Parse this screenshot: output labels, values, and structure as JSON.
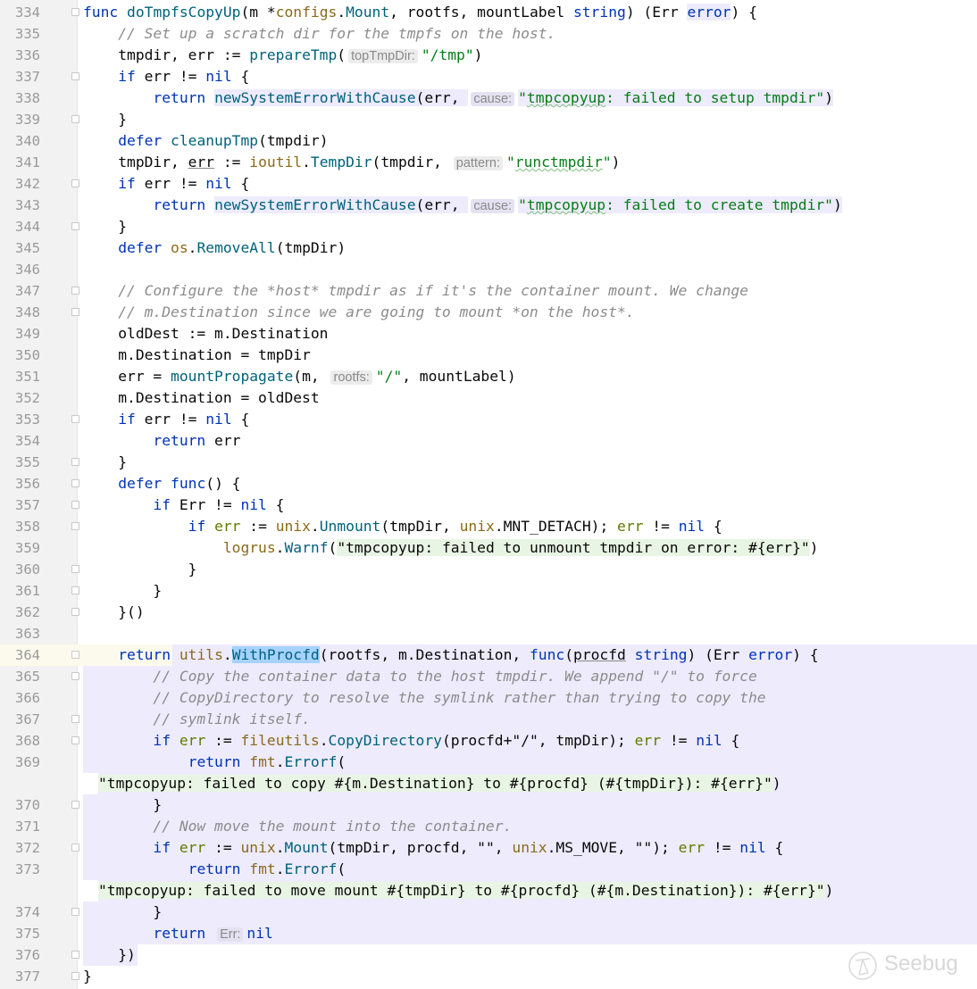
{
  "colors": {
    "keyword": "#0033b3",
    "function": "#00627a",
    "package": "#8a6a1c",
    "comment": "#8c8c8c",
    "string": "#067d17",
    "scope_highlight": "#edebfc",
    "current_line": "#fcfaed",
    "selection": "#a6d2ff"
  },
  "watermark": "Seebug",
  "lines": [
    {
      "n": "334",
      "fold": true,
      "t": [
        [
          "k",
          "func"
        ],
        [
          "",
          " "
        ],
        [
          "f",
          "doTmpfsCopyUp"
        ],
        [
          "",
          "(m *"
        ],
        [
          "p",
          "configs"
        ],
        [
          "",
          "."
        ],
        [
          "f",
          "Mount"
        ],
        [
          "",
          ", rootfs, mountLabel "
        ],
        [
          "k",
          "string"
        ],
        [
          "",
          ") (Err "
        ],
        [
          "kb",
          "error"
        ],
        [
          "",
          ") {"
        ]
      ]
    },
    {
      "n": "335",
      "t": [
        [
          "",
          "    "
        ],
        [
          "c",
          "// Set up a scratch dir for the tmpfs on the host."
        ]
      ]
    },
    {
      "n": "336",
      "t": [
        [
          "",
          "    tmpdir, err := "
        ],
        [
          "f",
          "prepareTmp"
        ],
        [
          "",
          "("
        ],
        [
          "h",
          "topTmpDir:"
        ],
        [
          "s",
          "\"/tmp\""
        ],
        [
          "",
          ")"
        ]
      ]
    },
    {
      "n": "337",
      "fold": true,
      "t": [
        [
          "",
          "    "
        ],
        [
          "k",
          "if"
        ],
        [
          "",
          " err != "
        ],
        [
          "k",
          "nil"
        ],
        [
          "",
          " {"
        ]
      ]
    },
    {
      "n": "338",
      "t": [
        [
          "",
          "        "
        ],
        [
          "k",
          "return"
        ],
        [
          "",
          " "
        ],
        [
          "f lv",
          "newSystemErrorWithCause"
        ],
        [
          "lv",
          "(err, "
        ],
        [
          "h lv",
          "cause:"
        ],
        [
          "s lv",
          "\""
        ],
        [
          "s lv w",
          "tmpcopyup"
        ],
        [
          "s lv",
          ": failed to setup tmpdir\""
        ],
        [
          "lv",
          ")"
        ]
      ]
    },
    {
      "n": "339",
      "fold": true,
      "t": [
        [
          "",
          "    }"
        ]
      ]
    },
    {
      "n": "340",
      "t": [
        [
          "",
          "    "
        ],
        [
          "k",
          "defer"
        ],
        [
          "",
          " "
        ],
        [
          "f",
          "cleanupTmp"
        ],
        [
          "",
          "(tmpdir)"
        ]
      ]
    },
    {
      "n": "341",
      "t": [
        [
          "",
          "    tmpDir, "
        ],
        [
          "u",
          "err"
        ],
        [
          "",
          " := "
        ],
        [
          "p",
          "ioutil"
        ],
        [
          "",
          "."
        ],
        [
          "f",
          "TempDir"
        ],
        [
          "",
          "(tmpdir, "
        ],
        [
          "h",
          "pattern:"
        ],
        [
          "s",
          "\""
        ],
        [
          "s w",
          "runctmpdir"
        ],
        [
          "s",
          "\""
        ],
        [
          "",
          ")"
        ]
      ]
    },
    {
      "n": "342",
      "fold": true,
      "t": [
        [
          "",
          "    "
        ],
        [
          "k",
          "if"
        ],
        [
          "",
          " err != "
        ],
        [
          "k",
          "nil"
        ],
        [
          "",
          " {"
        ]
      ]
    },
    {
      "n": "343",
      "t": [
        [
          "",
          "        "
        ],
        [
          "k",
          "return"
        ],
        [
          "",
          " "
        ],
        [
          "f lv",
          "newSystemErrorWithCause"
        ],
        [
          "lv",
          "(err, "
        ],
        [
          "h lv",
          "cause:"
        ],
        [
          "s lv",
          "\""
        ],
        [
          "s lv w",
          "tmpcopyup"
        ],
        [
          "s lv",
          ": failed to create tmpdir\""
        ],
        [
          "lv",
          ")"
        ]
      ]
    },
    {
      "n": "344",
      "fold": true,
      "t": [
        [
          "",
          "    }"
        ]
      ]
    },
    {
      "n": "345",
      "t": [
        [
          "",
          "    "
        ],
        [
          "k",
          "defer"
        ],
        [
          "",
          " "
        ],
        [
          "p",
          "os"
        ],
        [
          "",
          "."
        ],
        [
          "f",
          "RemoveAll"
        ],
        [
          "",
          "(tmpDir)"
        ]
      ]
    },
    {
      "n": "346",
      "t": []
    },
    {
      "n": "347",
      "fold": true,
      "t": [
        [
          "",
          "    "
        ],
        [
          "c",
          "// Configure the *host* tmpdir as if it's the container mount. We change"
        ]
      ]
    },
    {
      "n": "348",
      "fold": true,
      "t": [
        [
          "",
          "    "
        ],
        [
          "c",
          "// m.Destination since we are going to mount *on the host*."
        ]
      ]
    },
    {
      "n": "349",
      "t": [
        [
          "",
          "    oldDest := m.Destination"
        ]
      ]
    },
    {
      "n": "350",
      "t": [
        [
          "",
          "    m.Destination = tmpDir"
        ]
      ]
    },
    {
      "n": "351",
      "t": [
        [
          "",
          "    err = "
        ],
        [
          "f",
          "mountPropagate"
        ],
        [
          "",
          "(m, "
        ],
        [
          "h",
          "rootfs:"
        ],
        [
          "s",
          "\"/\""
        ],
        [
          "",
          ", mountLabel)"
        ]
      ]
    },
    {
      "n": "352",
      "t": [
        [
          "",
          "    m.Destination = oldDest"
        ]
      ]
    },
    {
      "n": "353",
      "fold": true,
      "t": [
        [
          "",
          "    "
        ],
        [
          "k",
          "if"
        ],
        [
          "",
          " err != "
        ],
        [
          "k",
          "nil"
        ],
        [
          "",
          " {"
        ]
      ]
    },
    {
      "n": "354",
      "t": [
        [
          "",
          "        "
        ],
        [
          "k",
          "return"
        ],
        [
          "",
          " err"
        ]
      ]
    },
    {
      "n": "355",
      "fold": true,
      "t": [
        [
          "",
          "    }"
        ]
      ]
    },
    {
      "n": "356",
      "fold": true,
      "t": [
        [
          "",
          "    "
        ],
        [
          "k",
          "defer"
        ],
        [
          "",
          " "
        ],
        [
          "k",
          "func"
        ],
        [
          "",
          "() {"
        ]
      ]
    },
    {
      "n": "357",
      "fold": true,
      "t": [
        [
          "",
          "        "
        ],
        [
          "k",
          "if"
        ],
        [
          "",
          " Err != "
        ],
        [
          "k",
          "nil"
        ],
        [
          "",
          " {"
        ]
      ]
    },
    {
      "n": "358",
      "fold": true,
      "t": [
        [
          "",
          "            "
        ],
        [
          "k",
          "if"
        ],
        [
          "",
          " "
        ],
        [
          "v",
          "err"
        ],
        [
          "",
          " := "
        ],
        [
          "p",
          "unix"
        ],
        [
          "",
          "."
        ],
        [
          "f",
          "Unmount"
        ],
        [
          "",
          "(tmpDir, "
        ],
        [
          "p",
          "unix"
        ],
        [
          "",
          ".MNT_DETACH); "
        ],
        [
          "v",
          "err"
        ],
        [
          "",
          " != "
        ],
        [
          "k",
          "nil"
        ],
        [
          "",
          " {"
        ]
      ]
    },
    {
      "n": "359",
      "t": [
        [
          "",
          "                "
        ],
        [
          "p",
          "logrus"
        ],
        [
          "",
          "."
        ],
        [
          "f",
          "Warnf"
        ],
        [
          "",
          "("
        ],
        [
          "sd",
          "\"tmpcopyup: failed to unmount tmpdir on error: #{err}\""
        ],
        [
          "",
          ")"
        ]
      ]
    },
    {
      "n": "360",
      "fold": true,
      "t": [
        [
          "",
          "            }"
        ]
      ]
    },
    {
      "n": "361",
      "fold": true,
      "t": [
        [
          "",
          "        }"
        ]
      ]
    },
    {
      "n": "362",
      "fold": true,
      "t": [
        [
          "",
          "    }()"
        ]
      ]
    },
    {
      "n": "363",
      "t": []
    },
    {
      "n": "364",
      "fold": true,
      "scope_start": true,
      "t": [
        [
          "",
          "    "
        ],
        [
          "k",
          "return"
        ],
        [
          "",
          " "
        ],
        [
          "p",
          "utils"
        ],
        [
          "",
          "."
        ],
        [
          "f sel",
          "WithProcfd"
        ],
        [
          "",
          "(rootfs, m.Destination, "
        ],
        [
          "k",
          "func"
        ],
        [
          "",
          "("
        ],
        [
          "u",
          "procfd"
        ],
        [
          "",
          " "
        ],
        [
          "k",
          "string"
        ],
        [
          "",
          ") (Err "
        ],
        [
          "k",
          "error"
        ],
        [
          "",
          ") {"
        ]
      ]
    },
    {
      "n": "365",
      "fold": true,
      "scope": true,
      "t": [
        [
          "",
          "        "
        ],
        [
          "c",
          "// Copy the container data to the host tmpdir. We append \"/\" to force"
        ]
      ]
    },
    {
      "n": "366",
      "scope": true,
      "t": [
        [
          "",
          "        "
        ],
        [
          "c",
          "// CopyDirectory to resolve the symlink rather than trying to copy the"
        ]
      ]
    },
    {
      "n": "367",
      "fold": true,
      "scope": true,
      "t": [
        [
          "",
          "        "
        ],
        [
          "c",
          "// symlink itself."
        ]
      ]
    },
    {
      "n": "368",
      "fold": true,
      "scope": true,
      "t": [
        [
          "",
          "        "
        ],
        [
          "k",
          "if"
        ],
        [
          "",
          " "
        ],
        [
          "v",
          "err"
        ],
        [
          "",
          " := "
        ],
        [
          "p",
          "fileutils"
        ],
        [
          "",
          "."
        ],
        [
          "f",
          "CopyDirectory"
        ],
        [
          "",
          "(procfd+\"/\", tmpDir); "
        ],
        [
          "v",
          "err"
        ],
        [
          "",
          " != "
        ],
        [
          "k",
          "nil"
        ],
        [
          "",
          " {"
        ]
      ]
    },
    {
      "n": "369",
      "scope": true,
      "t": [
        [
          "",
          "            "
        ],
        [
          "k",
          "return"
        ],
        [
          "",
          " "
        ],
        [
          "p",
          "fmt"
        ],
        [
          "",
          "."
        ],
        [
          "f",
          "Errorf"
        ],
        [
          "",
          "("
        ]
      ]
    },
    {
      "n": "",
      "scope": true,
      "cont": true,
      "t": [
        [
          "sd",
          "\"tmpcopyup: failed to copy #{m.Destination} to #{procfd} (#{tmpDir}): #{err}\""
        ],
        [
          "",
          ")"
        ]
      ]
    },
    {
      "n": "370",
      "fold": true,
      "scope": true,
      "t": [
        [
          "",
          "        }"
        ]
      ]
    },
    {
      "n": "371",
      "scope": true,
      "t": [
        [
          "",
          "        "
        ],
        [
          "c",
          "// Now move the mount into the container."
        ]
      ]
    },
    {
      "n": "372",
      "fold": true,
      "scope": true,
      "t": [
        [
          "",
          "        "
        ],
        [
          "k",
          "if"
        ],
        [
          "",
          " "
        ],
        [
          "v",
          "err"
        ],
        [
          "",
          " := "
        ],
        [
          "p",
          "unix"
        ],
        [
          "",
          "."
        ],
        [
          "f",
          "Mount"
        ],
        [
          "",
          "(tmpDir, procfd, \"\", "
        ],
        [
          "p",
          "unix"
        ],
        [
          "",
          ".MS_MOVE, \"\"); "
        ],
        [
          "v",
          "err"
        ],
        [
          "",
          " != "
        ],
        [
          "k",
          "nil"
        ],
        [
          "",
          " {"
        ]
      ]
    },
    {
      "n": "373",
      "scope": true,
      "t": [
        [
          "",
          "            "
        ],
        [
          "k",
          "return"
        ],
        [
          "",
          " "
        ],
        [
          "p",
          "fmt"
        ],
        [
          "",
          "."
        ],
        [
          "f",
          "Errorf"
        ],
        [
          "",
          "("
        ]
      ]
    },
    {
      "n": "",
      "scope": true,
      "cont": true,
      "t": [
        [
          "sd",
          "\"tmpcopyup: failed to move mount #{tmpDir} to #{procfd} (#{m.Destination}): #{err}\""
        ],
        [
          "",
          ")"
        ]
      ]
    },
    {
      "n": "374",
      "fold": true,
      "scope": true,
      "t": [
        [
          "",
          "        }"
        ]
      ]
    },
    {
      "n": "375",
      "scope": true,
      "t": [
        [
          "",
          "        "
        ],
        [
          "k",
          "return"
        ],
        [
          "",
          " "
        ],
        [
          "h lv",
          "Err:"
        ],
        [
          "k",
          "nil"
        ]
      ]
    },
    {
      "n": "376",
      "fold": true,
      "scope_end": true,
      "t": [
        [
          "",
          "    })"
        ]
      ]
    },
    {
      "n": "377",
      "fold": true,
      "t": [
        [
          "",
          "}"
        ]
      ]
    }
  ]
}
